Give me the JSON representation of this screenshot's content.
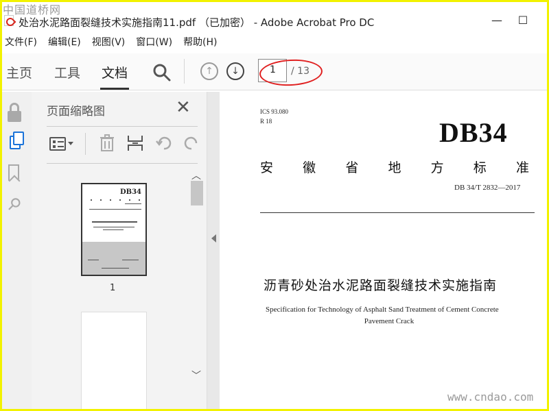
{
  "watermark": {
    "top": "中国道桥网",
    "bottom": "www.cndao.com"
  },
  "window": {
    "title": "处治水泥路面裂缝技术实施指南11.pdf （已加密） - Adobe Acrobat Pro DC",
    "minimize": "—",
    "maximize": "☐"
  },
  "menu": [
    "文件(F)",
    "编辑(E)",
    "视图(V)",
    "窗口(W)",
    "帮助(H)"
  ],
  "toolbar": {
    "tabs": [
      "主页",
      "工具",
      "文档"
    ],
    "active_tab": "文档",
    "page_current": "1",
    "page_total": "/ 13"
  },
  "icons": {
    "search": "search-icon",
    "prev": "arrow-up-circle-icon",
    "next": "arrow-down-circle-icon",
    "lock": "lock-icon",
    "pages": "pages-icon",
    "bookmark": "bookmark-icon",
    "attachment": "paperclip-icon"
  },
  "panel": {
    "title": "页面缩略图",
    "close": "✕",
    "thumb1_label": "1",
    "thumb1_db": "DB34"
  },
  "document": {
    "ics": "ICS 93.080",
    "r": "R 18",
    "db": "DB34",
    "province": [
      "安",
      "徽",
      "省",
      "地",
      "方",
      "标",
      "准"
    ],
    "std_number": "DB 34/T 2832—2017",
    "title_cn": "沥青砂处治水泥路面裂缝技术实施指南",
    "title_en_1": "Specification for Technology of Asphalt Sand Treatment of Cement Concrete",
    "title_en_2": "Pavement Crack"
  },
  "colors": {
    "highlight_ellipse": "#e02020",
    "active_icon": "#1a73d9",
    "frame": "#f2f200"
  }
}
